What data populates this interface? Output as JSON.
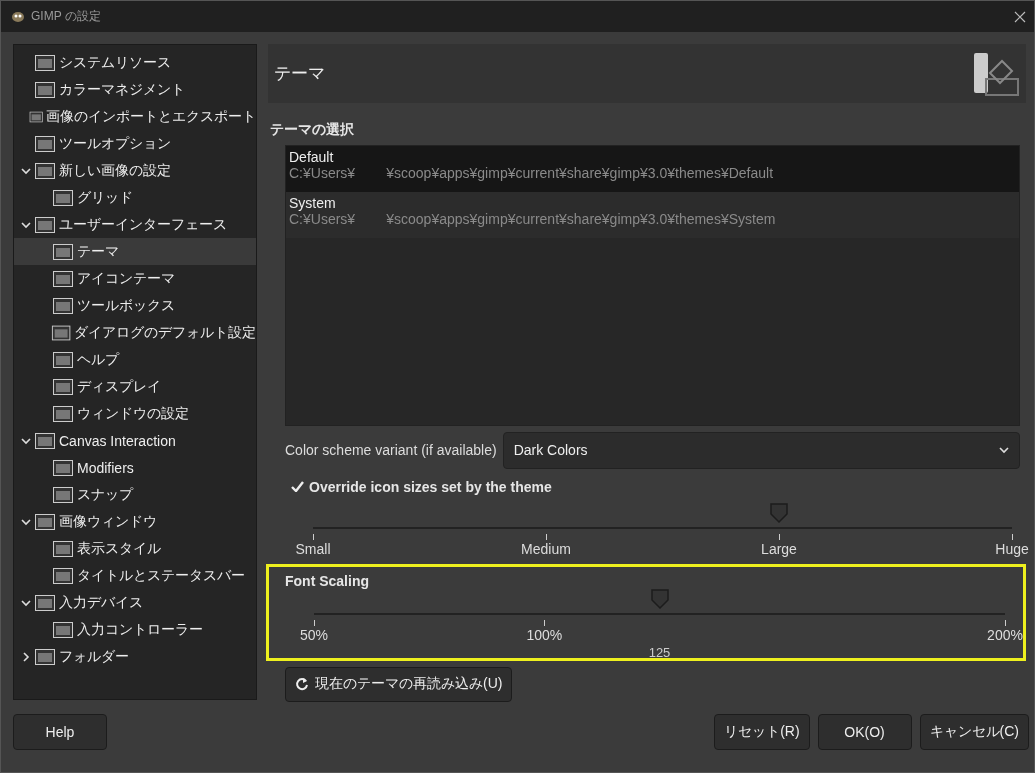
{
  "window": {
    "title": "GIMP の設定"
  },
  "sidebar": {
    "items": [
      {
        "label": "システムリソース",
        "selected": false
      },
      {
        "label": "カラーマネジメント",
        "selected": false
      },
      {
        "label": "画像のインポートとエクスポート",
        "selected": false
      },
      {
        "label": "ツールオプション",
        "selected": false
      },
      {
        "label": "新しい画像の設定",
        "selected": false,
        "expanded": true,
        "children": [
          {
            "label": "グリッド",
            "selected": false
          }
        ]
      },
      {
        "label": "ユーザーインターフェース",
        "selected": false,
        "expanded": true,
        "children": [
          {
            "label": "テーマ",
            "selected": true
          },
          {
            "label": "アイコンテーマ",
            "selected": false
          },
          {
            "label": "ツールボックス",
            "selected": false
          },
          {
            "label": "ダイアログのデフォルト設定",
            "selected": false
          },
          {
            "label": "ヘルプ",
            "selected": false
          },
          {
            "label": "ディスプレイ",
            "selected": false
          },
          {
            "label": "ウィンドウの設定",
            "selected": false
          }
        ]
      },
      {
        "label": "Canvas Interaction",
        "selected": false,
        "expanded": true,
        "children": [
          {
            "label": "Modifiers",
            "selected": false
          },
          {
            "label": "スナップ",
            "selected": false
          }
        ]
      },
      {
        "label": "画像ウィンドウ",
        "selected": false,
        "expanded": true,
        "children": [
          {
            "label": "表示スタイル",
            "selected": false
          },
          {
            "label": "タイトルとステータスバー",
            "selected": false
          }
        ]
      },
      {
        "label": "入力デバイス",
        "selected": false,
        "expanded": true,
        "children": [
          {
            "label": "入力コントローラー",
            "selected": false
          }
        ]
      },
      {
        "label": "フォルダー",
        "selected": false,
        "expanded": false
      }
    ]
  },
  "page": {
    "title": "テーマ",
    "section": "テーマの選択",
    "themes": [
      {
        "name": "Default",
        "path": "C:¥Users¥        ¥scoop¥apps¥gimp¥current¥share¥gimp¥3.0¥themes¥Default",
        "selected": true
      },
      {
        "name": "System",
        "path": "C:¥Users¥        ¥scoop¥apps¥gimp¥current¥share¥gimp¥3.0¥themes¥System",
        "selected": false
      }
    ],
    "color_scheme": {
      "label": "Color scheme variant (if available)",
      "value": "Dark Colors"
    },
    "override_icon_sizes": {
      "label": "Override icon sizes set by the theme",
      "checked": true
    },
    "icon_size": {
      "level": 0.667,
      "ticks": [
        "Small",
        "Medium",
        "Large",
        "Huge"
      ]
    },
    "font_scaling": {
      "title": "Font Scaling",
      "level": 0.5,
      "ticks": [
        "50%",
        "100%",
        "200%"
      ],
      "value": "125"
    },
    "reload_button": "現在のテーマの再読み込み(U)"
  },
  "buttons": {
    "help": "Help",
    "right": [
      "リセット(R)",
      "OK(O)",
      "キャンセル(C)"
    ]
  }
}
